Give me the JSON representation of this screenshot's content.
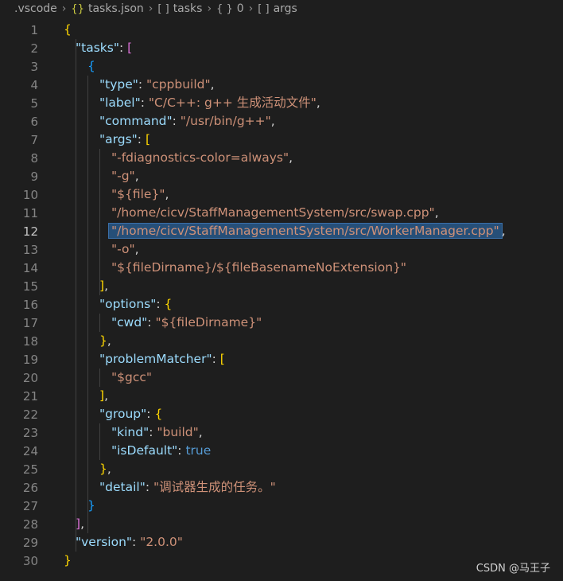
{
  "breadcrumb": {
    "folder": ".vscode",
    "file_icon": "{}",
    "file": "tasks.json",
    "arr_icon_1": "[ ]",
    "seg1": "tasks",
    "obj_icon": "{ }",
    "seg2": "0",
    "arr_icon_2": "[ ]",
    "seg3": "args"
  },
  "gutter": [
    "1",
    "2",
    "3",
    "4",
    "5",
    "6",
    "7",
    "8",
    "9",
    "10",
    "11",
    "12",
    "13",
    "14",
    "15",
    "16",
    "17",
    "18",
    "19",
    "20",
    "21",
    "22",
    "23",
    "24",
    "25",
    "26",
    "27",
    "28",
    "29",
    "30"
  ],
  "active_line": "12",
  "code": {
    "l1": "{",
    "l2_key": "\"tasks\"",
    "l3": "{",
    "l4_key": "\"type\"",
    "l4_val": "\"cppbuild\"",
    "l5_key": "\"label\"",
    "l5_val": "\"C/C++: g++ 生成活动文件\"",
    "l6_key": "\"command\"",
    "l6_val": "\"/usr/bin/g++\"",
    "l7_key": "\"args\"",
    "l8": "\"-fdiagnostics-color=always\"",
    "l9": "\"-g\"",
    "l10": "\"${file}\"",
    "l11": "\"/home/cicv/StaffManagementSystem/src/swap.cpp\"",
    "l12": "\"/home/cicv/StaffManagementSystem/src/WorkerManager.cpp\"",
    "l13": "\"-o\"",
    "l14": "\"${fileDirname}/${fileBasenameNoExtension}\"",
    "l16_key": "\"options\"",
    "l17_key": "\"cwd\"",
    "l17_val": "\"${fileDirname}\"",
    "l19_key": "\"problemMatcher\"",
    "l20": "\"$gcc\"",
    "l22_key": "\"group\"",
    "l23_key": "\"kind\"",
    "l23_val": "\"build\"",
    "l24_key": "\"isDefault\"",
    "l24_val": "true",
    "l26_key": "\"detail\"",
    "l26_val": "\"调试器生成的任务。\"",
    "l29_key": "\"version\"",
    "l29_val": "\"2.0.0\""
  },
  "watermark": "CSDN @马王子"
}
